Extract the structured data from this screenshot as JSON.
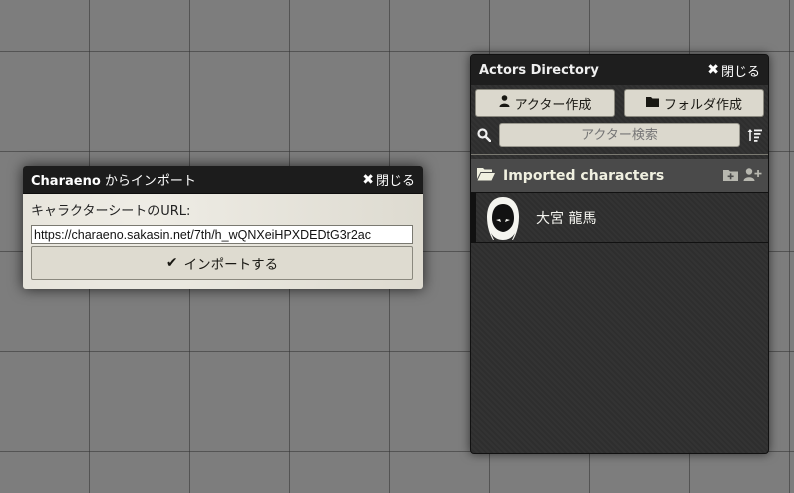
{
  "import_dialog": {
    "title_main": "Charaeno",
    "title_sub": " からインポート",
    "close_label": "閉じる",
    "url_label": "キャラクターシートのURL:",
    "url_value": "https://charaeno.sakasin.net/7th/h_wQNXeiHPXDEDtG3r2ac",
    "import_button": "インポートする"
  },
  "actors_directory": {
    "title": "Actors Directory",
    "close_label": "閉じる",
    "create_actor_button": "アクター作成",
    "create_folder_button": "フォルダ作成",
    "search_placeholder": "アクター検索",
    "folders": [
      {
        "name": "Imported characters",
        "actors": [
          {
            "name": "大宮 龍馬"
          }
        ]
      }
    ]
  },
  "icons": {
    "close": "close-icon",
    "check": "check-icon",
    "user": "user-icon",
    "folder": "folder-icon",
    "search": "search-icon",
    "sort": "sort-icon",
    "folder_open": "folder-open-icon",
    "folder_plus": "folder-plus-icon",
    "user_plus": "user-plus-icon",
    "hooded_figure": "hooded-figure-icon"
  },
  "colors": {
    "background": "#7d7d7d",
    "panel_dark": "#2e2e2e",
    "header_dark": "#1c1c1c",
    "parchment": "#e6e3d8",
    "button": "#dbd8cd"
  }
}
